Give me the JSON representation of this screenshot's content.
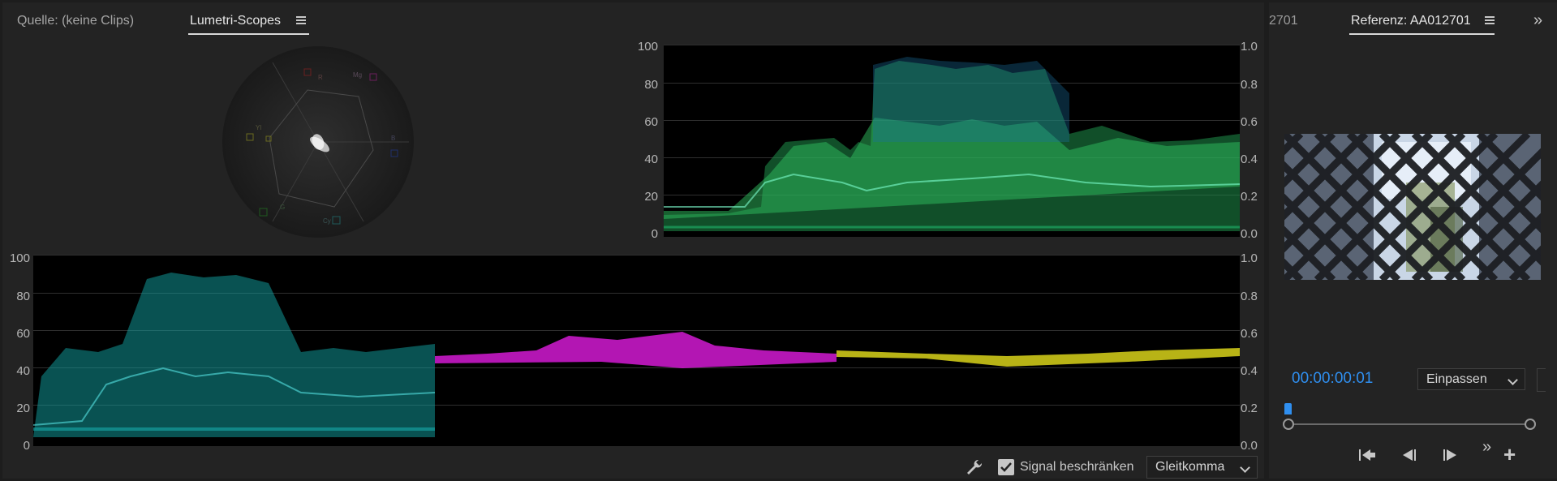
{
  "left_panel": {
    "tabs": [
      {
        "label": "Quelle: (keine Clips)",
        "active": false
      },
      {
        "label": "Lumetri-Scopes",
        "active": true
      }
    ],
    "menu_icon": "hamburger-menu-icon"
  },
  "right_panel": {
    "partial_tab": "2701",
    "tab_label": "Referenz: AA012701",
    "menu_icon": "hamburger-menu-icon",
    "overflow_icon": "double-chevron-right-icon",
    "timecode": "00:00:00:01",
    "fit_dropdown": "Einpassen",
    "transport": [
      "step-to-in-icon",
      "step-back-frame-icon",
      "step-forward-frame-icon",
      "double-chevron-right-icon",
      "add-button-icon"
    ]
  },
  "vectorscope": {
    "labels": [
      "R",
      "Mg",
      "B",
      "Cy",
      "G",
      "Yl"
    ]
  },
  "waveform_top": {
    "left_axis": [
      "100",
      "80",
      "60",
      "40",
      "20",
      "0"
    ],
    "right_axis": [
      "1.0",
      "0.8",
      "0.6",
      "0.4",
      "0.2",
      "0.0"
    ]
  },
  "parade_bottom": {
    "left_axis": [
      "100",
      "80",
      "60",
      "40",
      "20",
      "0"
    ],
    "right_axis": [
      "1.0",
      "0.8",
      "0.6",
      "0.4",
      "0.2",
      "0.0"
    ],
    "channels": [
      {
        "color": "#19b3b3",
        "level_percent": 35
      },
      {
        "color": "#d21ad2",
        "level_percent": 48
      },
      {
        "color": "#d8d21a",
        "level_percent": 49
      }
    ]
  },
  "bottom_controls": {
    "settings_icon": "wrench-icon",
    "clamp_checkbox_checked": true,
    "clamp_label": "Signal beschränken",
    "format_dropdown": "Gleitkomma"
  },
  "colors": {
    "accent_blue": "#2f8ff0",
    "waveform_green": "#2fbf5f",
    "panel_bg": "#232323"
  }
}
